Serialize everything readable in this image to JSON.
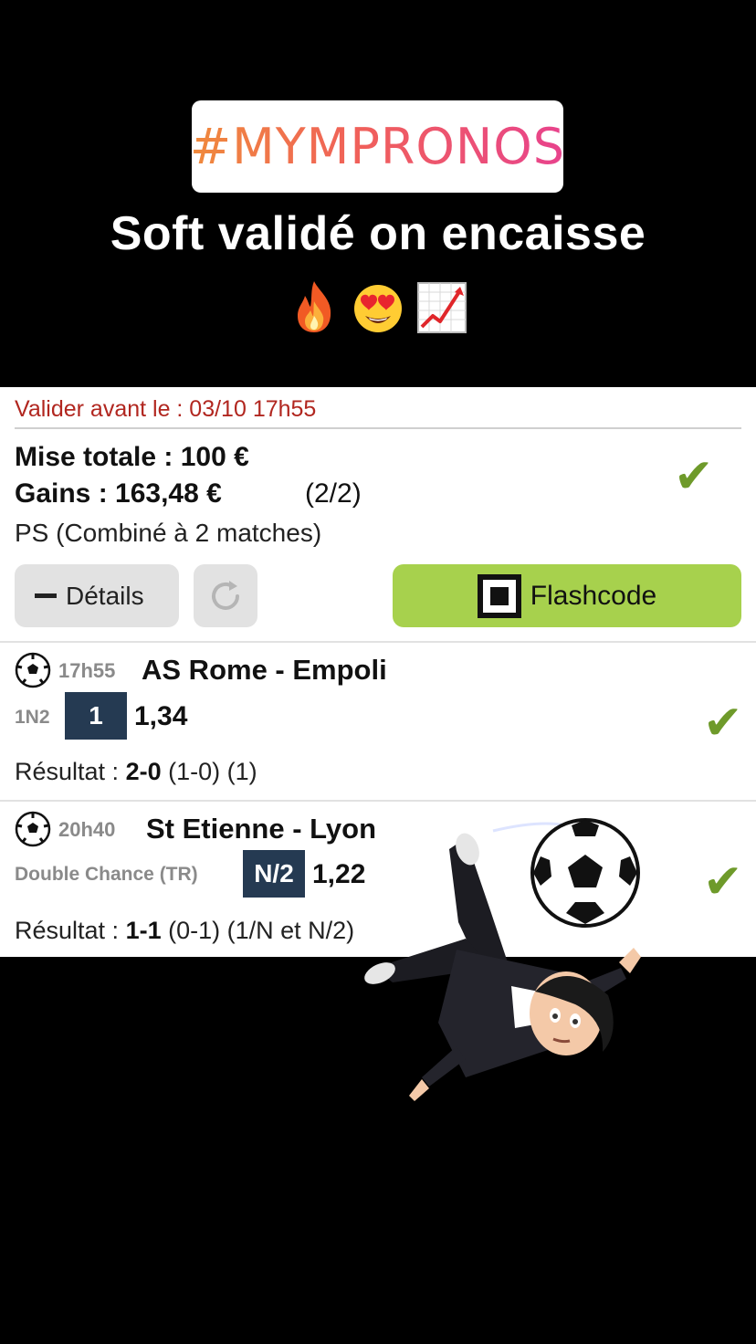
{
  "story": {
    "hashtag": "#MYMPRONOS",
    "caption": "Soft validé on encaisse",
    "emojis": [
      "fire-emoji",
      "heart-eyes-emoji",
      "chart-increasing-emoji"
    ]
  },
  "bet": {
    "deadline": "Valider avant le : 03/10 17h55",
    "stake_label": "Mise totale : 100 €",
    "gains_label": "Gains : 163,48 €",
    "gains_count": "(2/2)",
    "type": "PS (Combiné à 2 matches)",
    "status_icon": "check-icon",
    "buttons": {
      "details": "Détails",
      "flashcode": "Flashcode"
    },
    "colors": {
      "deadline": "#b1261f",
      "check": "#6e9a2a",
      "flashcode_bg": "#a7d14d",
      "pick_bg": "#253a52"
    }
  },
  "matches": [
    {
      "time": "17h55",
      "teams": "AS Rome - Empoli",
      "market": "1N2",
      "pick": "1",
      "odds": "1,34",
      "result_label": "Résultat : ",
      "result_score": "2-0",
      "result_detail": " (1-0) (1)"
    },
    {
      "time": "20h40",
      "teams": "St Etienne - Lyon",
      "market": "Double Chance (TR)",
      "pick": "N/2",
      "odds": "1,22",
      "result_label": "Résultat : ",
      "result_score": "1-1",
      "result_detail": " (0-1) (1/N et N/2)"
    }
  ]
}
